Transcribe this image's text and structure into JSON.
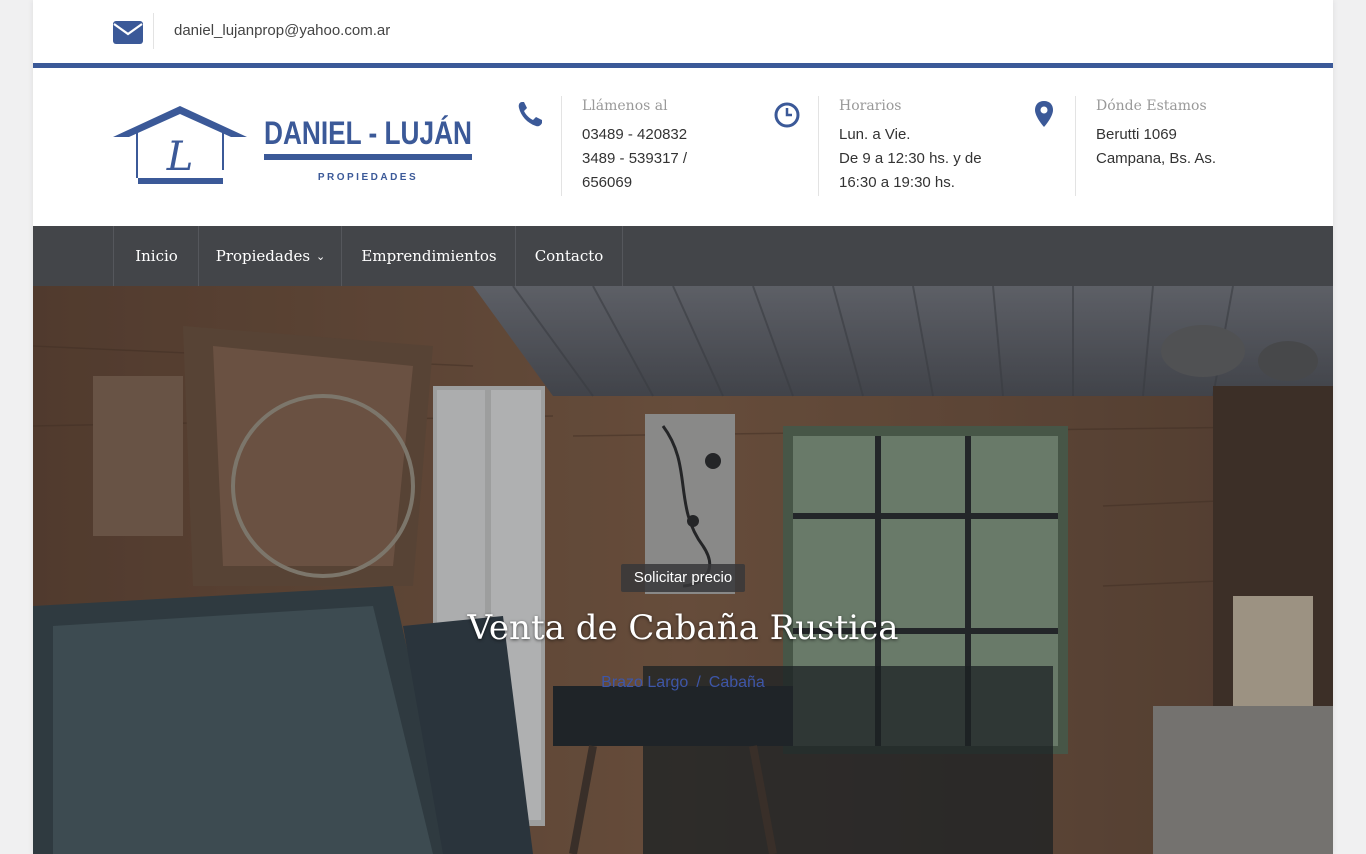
{
  "topbar": {
    "email": "daniel_lujanprop@yahoo.com.ar",
    "email_icon": "envelope-icon"
  },
  "brand": {
    "name": "DANIEL - LUJÁN",
    "tagline": "PROPIEDADES",
    "monogram": "L",
    "color": "#3b5998"
  },
  "contact_info": [
    {
      "icon": "phone-icon",
      "title": "Llámenos al",
      "lines": [
        "03489 - 420832",
        "3489 - 539317 /",
        "656069"
      ]
    },
    {
      "icon": "clock-icon",
      "title": "Horarios",
      "lines": [
        "Lun. a Vie.",
        "De 9 a 12:30 hs. y de",
        "16:30 a 19:30 hs."
      ]
    },
    {
      "icon": "map-marker-icon",
      "title": "Dónde Estamos",
      "lines": [
        "Berutti 1069",
        "Campana, Bs. As."
      ]
    }
  ],
  "nav": {
    "items": [
      {
        "label": "Inicio"
      },
      {
        "label": "Propiedades",
        "has_dropdown": true
      },
      {
        "label": "Emprendimientos"
      },
      {
        "label": "Contacto"
      }
    ],
    "background": "#434549"
  },
  "hero": {
    "badge": "Solicitar precio",
    "title": "Venta de Cabaña Rustica",
    "breadcrumb": [
      "Brazo Largo",
      "Cabaña"
    ],
    "breadcrumb_separator": "/",
    "link_color": "#3d56a8"
  }
}
